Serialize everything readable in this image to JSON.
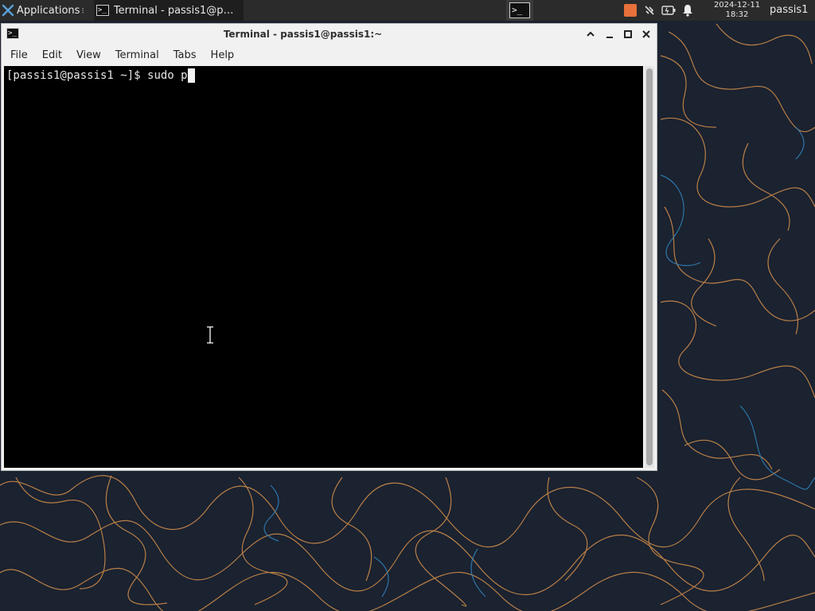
{
  "panel": {
    "applications_label": "Applications",
    "task_label": "Terminal - passis1@p…",
    "clock_date": "2024-12-11",
    "clock_time": "18:32",
    "user_label": "passis1"
  },
  "icons": {
    "applications": "xfce-mouse-icon",
    "terminal": "terminal-icon",
    "updates": "updates-icon",
    "network": "network-disconnected-icon",
    "battery": "battery-icon",
    "notifications": "bell-icon"
  },
  "window": {
    "title": "Terminal - passis1@passis1:~",
    "menu": [
      "File",
      "Edit",
      "View",
      "Terminal",
      "Tabs",
      "Help"
    ]
  },
  "terminal": {
    "prompt": "[passis1@passis1 ~]$ ",
    "input": "sudo p"
  },
  "colors": {
    "panel_bg": "#2b2b2b",
    "window_bg": "#f1f1f1",
    "terminal_bg": "#000000",
    "terminal_fg": "#e6e6e6",
    "wallpaper_bg": "#1b2230",
    "wallpaper_line_orange": "#c98a4a",
    "wallpaper_line_blue": "#2f7fb5"
  }
}
